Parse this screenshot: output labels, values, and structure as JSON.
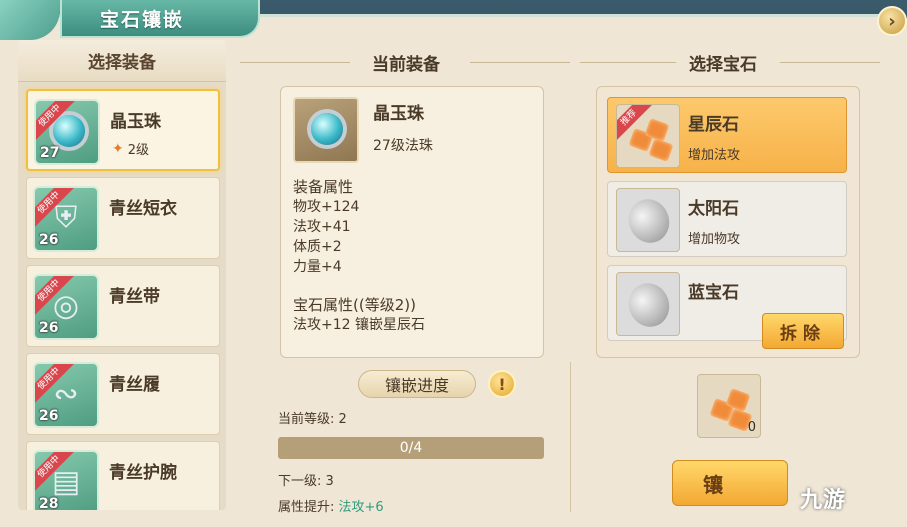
{
  "window": {
    "title": "宝石镶嵌",
    "close_icon": "close-icon"
  },
  "left": {
    "header": "选择装备",
    "items": [
      {
        "name": "晶玉珠",
        "level": "27",
        "badge": "使用中",
        "gem_level": "2级",
        "icon": "orb-icon",
        "selected": true
      },
      {
        "name": "青丝短衣",
        "level": "26",
        "badge": "使用中",
        "icon": "armor-icon",
        "selected": false
      },
      {
        "name": "青丝带",
        "level": "26",
        "badge": "使用中",
        "icon": "belt-icon",
        "selected": false
      },
      {
        "name": "青丝履",
        "level": "26",
        "badge": "使用中",
        "icon": "boots-icon",
        "selected": false
      },
      {
        "name": "青丝护腕",
        "level": "28",
        "badge": "使用中",
        "icon": "bracer-icon",
        "selected": false
      }
    ]
  },
  "middle": {
    "header": "当前装备",
    "equip_name": "晶玉珠",
    "equip_sub": "27级法珠",
    "attr_header": "装备属性",
    "attrs": [
      "物攻+124",
      "法攻+41",
      "体质+2",
      "力量+4"
    ],
    "gem_attr_header": "宝石属性((等级2))",
    "gem_attr_line": "法攻+12 镶嵌星辰石",
    "progress_label": "镶嵌进度",
    "current_level": "当前等级: 2",
    "progress_text": "0/4",
    "progress_value": 0,
    "next_level": "下一级: 3",
    "attr_up_label": "属性提升: ",
    "attr_up_value": "法攻+6"
  },
  "right": {
    "header": "选择宝石",
    "gems": [
      {
        "name": "星辰石",
        "desc": "增加法攻",
        "badge": "推荐",
        "icon": "star-gem-icon",
        "selected": true
      },
      {
        "name": "太阳石",
        "desc": "增加物攻",
        "icon": "sun-stone-icon",
        "selected": false
      },
      {
        "name": "蓝宝石",
        "desc": "",
        "icon": "sapphire-icon",
        "selected": false
      }
    ],
    "remove_button": "拆除",
    "slot_count": "0",
    "embed_button": "镶"
  },
  "watermark": "九游",
  "colors": {
    "accent": "#f3a833",
    "selected_border": "#f1c040",
    "teal": "#3d8d80",
    "bonus": "#2e9d7e",
    "badge_red": "#d9474d"
  }
}
